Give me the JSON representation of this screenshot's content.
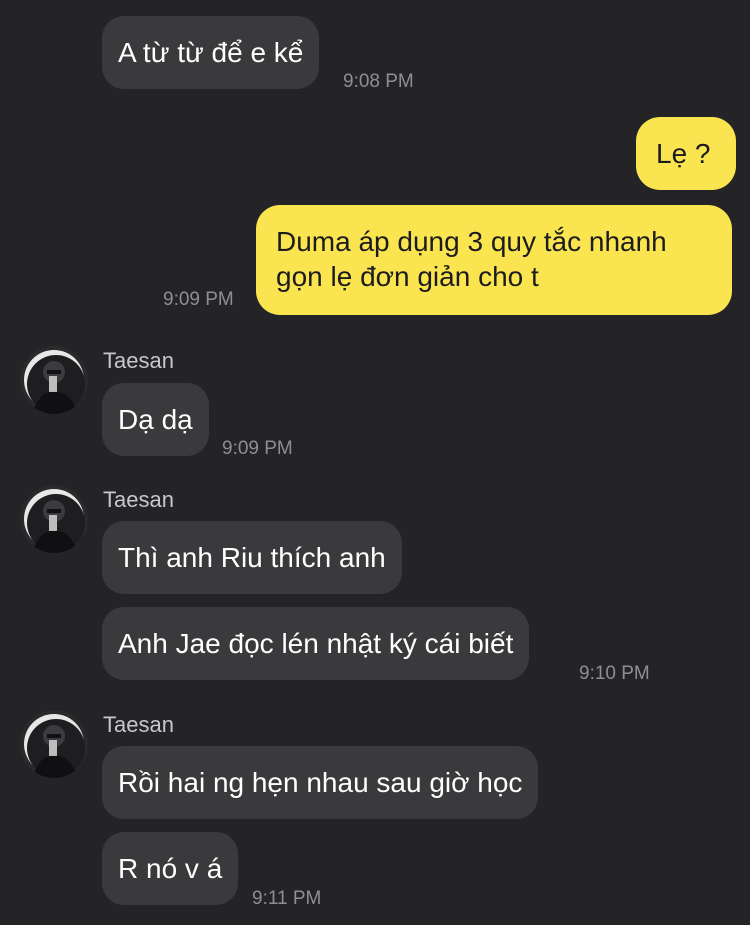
{
  "messages": {
    "m1": {
      "text": "A từ từ để e kể",
      "time": "9:08 PM"
    },
    "m2": {
      "text": "Lẹ ?"
    },
    "m3": {
      "line1": "Duma áp dụng 3 quy tắc nhanh",
      "line2": "gọn lẹ đơn giản cho t",
      "time": "9:09 PM"
    },
    "g1": {
      "sender": "Taesan",
      "text": "Dạ dạ",
      "time": "9:09 PM"
    },
    "g2": {
      "sender": "Taesan",
      "text1": "Thì anh Riu thích anh",
      "text2": "Anh Jae đọc lén nhật ký cái biết",
      "time": "9:10 PM"
    },
    "g3": {
      "sender": "Taesan",
      "text1": "Rồi hai ng hẹn nhau sau giờ học",
      "text2": "R nó v á",
      "time": "9:11 PM"
    }
  },
  "colors": {
    "background": "#242426",
    "incoming_bubble": "#3a3a3c",
    "outgoing_bubble": "#fae550",
    "timestamp": "#8e8e93"
  },
  "icons": {
    "avatar": "contact-avatar-photo"
  }
}
